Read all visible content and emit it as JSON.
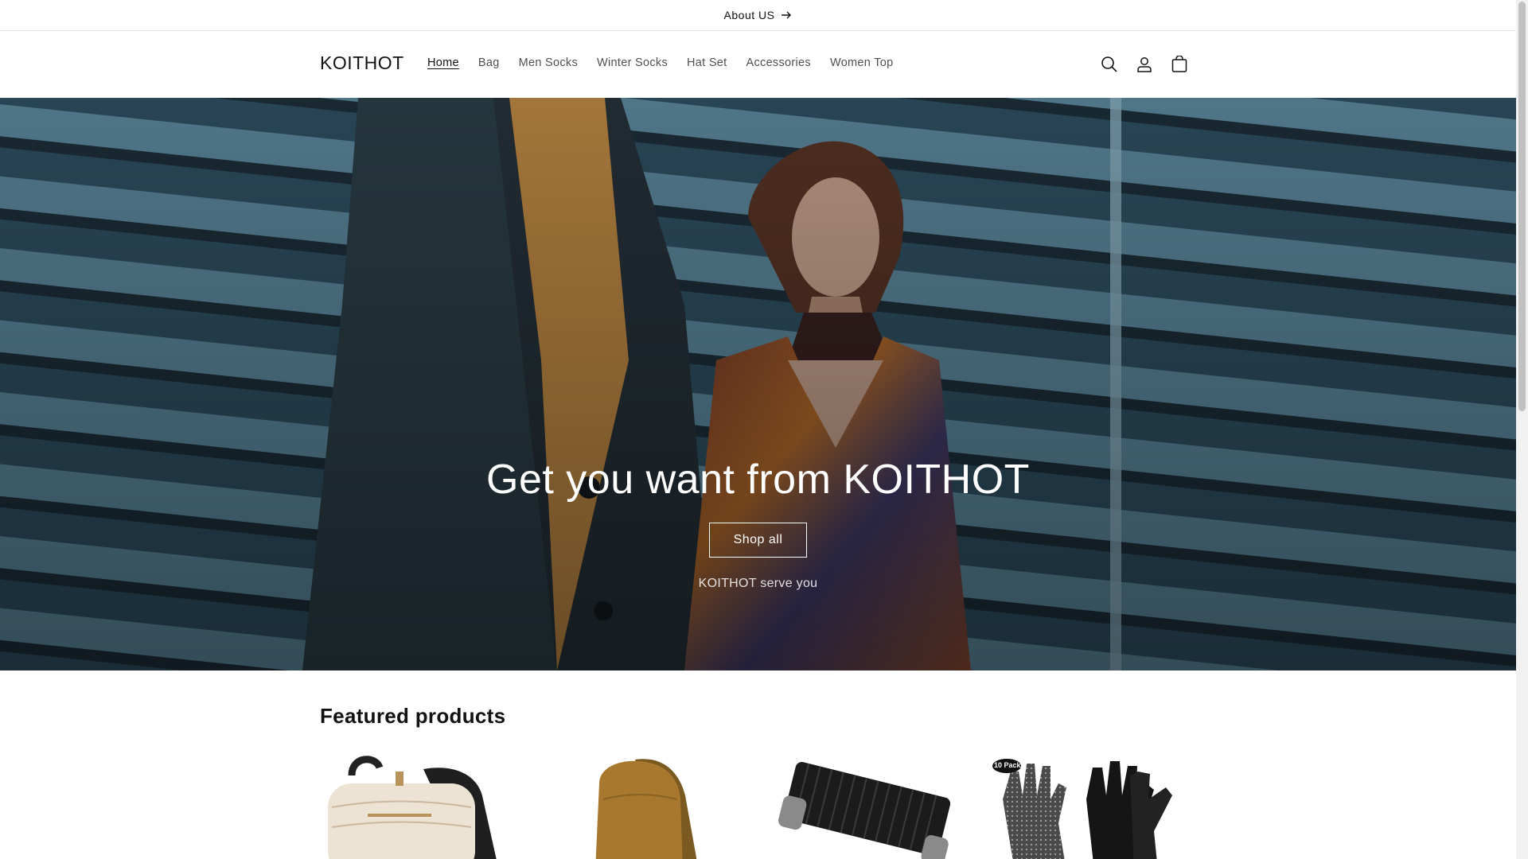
{
  "announcement": {
    "text": "About US"
  },
  "header": {
    "logo": "KOITHOT",
    "nav": [
      {
        "label": "Home",
        "active": true
      },
      {
        "label": "Bag"
      },
      {
        "label": "Men Socks"
      },
      {
        "label": "Winter Socks"
      },
      {
        "label": "Hat Set"
      },
      {
        "label": "Accessories"
      },
      {
        "label": "Women Top"
      }
    ],
    "icons": [
      "search-icon",
      "account-icon",
      "cart-icon"
    ]
  },
  "hero": {
    "title": "Get you want from KOITHOT",
    "button": "Shop all",
    "subtitle": "KOITHOT serve you"
  },
  "featured": {
    "title": "Featured products",
    "products": [
      {
        "image": "cream-backpack"
      },
      {
        "image": "tan-backpack"
      },
      {
        "image": "black-socks-bundle"
      },
      {
        "image": "gloves-10-pack",
        "badge": "10 Pack"
      }
    ]
  }
}
